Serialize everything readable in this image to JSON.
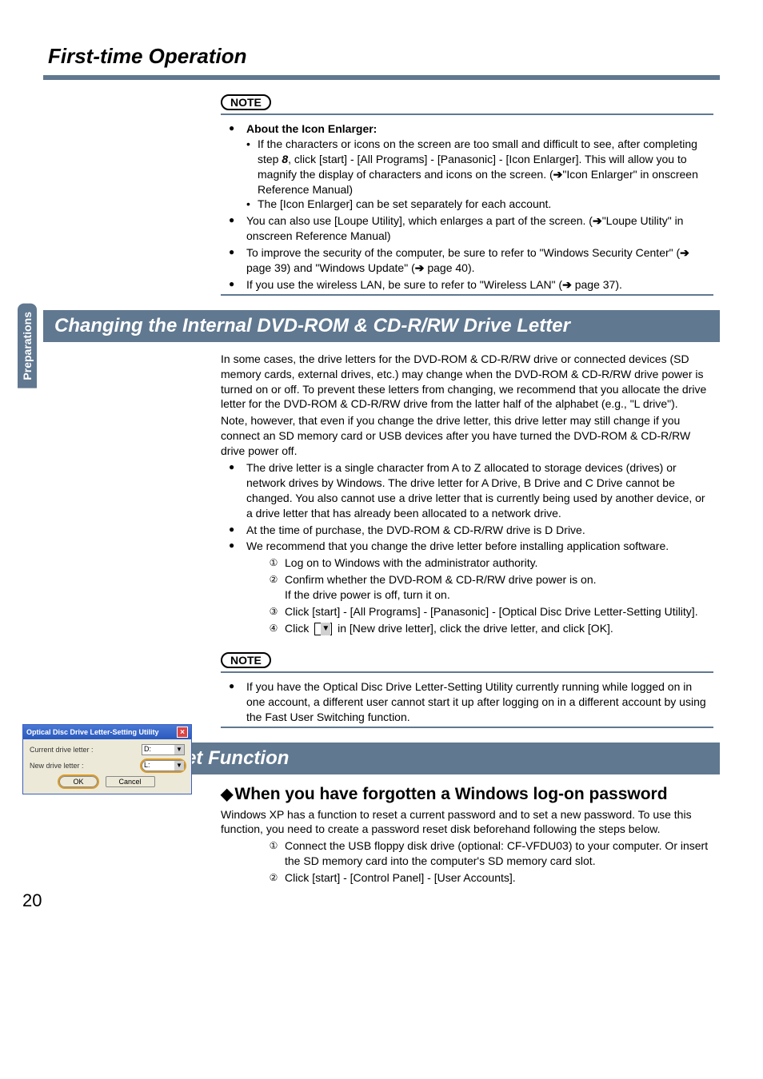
{
  "page": {
    "title": "First-time Operation",
    "sideTab": "Preparations",
    "pageNumber": "20"
  },
  "note1": {
    "label": "NOTE",
    "b1_title": "About the Icon Enlarger:",
    "b1_s1a": "If the characters or icons on the screen are too small and difficult to see, after completing step ",
    "b1_s1_step": "8",
    "b1_s1b": ", click [start] - [All Programs] - [Panasonic] - [Icon Enlarger]. This will allow you to magnify the display of characters and icons on the screen. (",
    "b1_s1c": "\"Icon Enlarger\" in onscreen Reference Manual)",
    "b1_s2": "The [Icon Enlarger] can be set separately for each account.",
    "b2a": "You can also use [Loupe Utility], which enlarges a part of the screen. (",
    "b2b": "\"Loupe Utility\" in onscreen Reference Manual)",
    "b3a": "To improve the security of the computer, be sure to refer to \"Windows Security Center\" (",
    "b3b": " page 39) and \"Windows Update\" (",
    "b3c": " page 40).",
    "b4a": "If you use the wireless LAN, be sure to refer to \"Wireless LAN\" (",
    "b4b": " page 37)."
  },
  "section1": {
    "heading": "Changing the Internal DVD-ROM & CD-R/RW Drive Letter",
    "p1": "In some cases, the drive letters for the DVD-ROM & CD-R/RW drive or connected devices (SD memory cards, external drives, etc.) may change when the DVD-ROM & CD-R/RW drive power is turned on or off. To prevent these letters from changing, we recommend that you allocate the drive letter for the DVD-ROM & CD-R/RW drive from the latter half of the alphabet (e.g., \"L drive\").",
    "p2": "Note, however, that even if you change the drive letter, this drive letter may still change if you connect an SD memory card or USB devices after you have turned the DVD-ROM & CD-R/RW drive power off.",
    "b1": "The drive letter is a single character from A to Z allocated to storage devices (drives) or network drives by Windows. The drive letter for A Drive, B Drive and C Drive cannot be changed. You also cannot use a drive letter that is currently being used by another device, or a drive letter that has already been allocated to a network drive.",
    "b2": "At the time of purchase, the DVD-ROM & CD-R/RW drive is D Drive.",
    "b3": "We recommend that you change the drive letter before installing application software.",
    "s1": "Log on to Windows with the administrator authority.",
    "s2a": "Confirm whether the DVD-ROM & CD-R/RW drive power is on.",
    "s2b": "If the drive power is off, turn it on.",
    "s3": "Click [start] - [All Programs] - [Panasonic] - [Optical Disc Drive Letter-Setting Utility].",
    "s4a": "Click ",
    "s4b": " in [New drive letter], click the drive letter, and click [OK]."
  },
  "note2": {
    "label": "NOTE",
    "b1": "If you have the Optical Disc Drive Letter-Setting Utility currently running while logged on in one account, a different user cannot start it up after logging on in a different account by using the Fast User Switching function."
  },
  "section2": {
    "heading": "Password Reset Function",
    "sub": "When you have forgotten a Windows log-on password",
    "p1": "Windows XP has a function to reset a current password and to set a new password. To use this function, you need to create a password reset disk beforehand following the steps below.",
    "s1": "Connect the USB floppy disk drive (optional: CF-VFDU03) to your computer.  Or insert the SD memory card into the computer's SD memory card slot.",
    "s2": "Click [start] - [Control Panel] - [User Accounts]."
  },
  "utility": {
    "title": "Optical Disc Drive Letter-Setting Utility",
    "currentLabel": "Current drive letter :",
    "currentValue": "D:",
    "newLabel": "New drive letter :",
    "newValue": "L:",
    "ok": "OK",
    "cancel": "Cancel"
  }
}
